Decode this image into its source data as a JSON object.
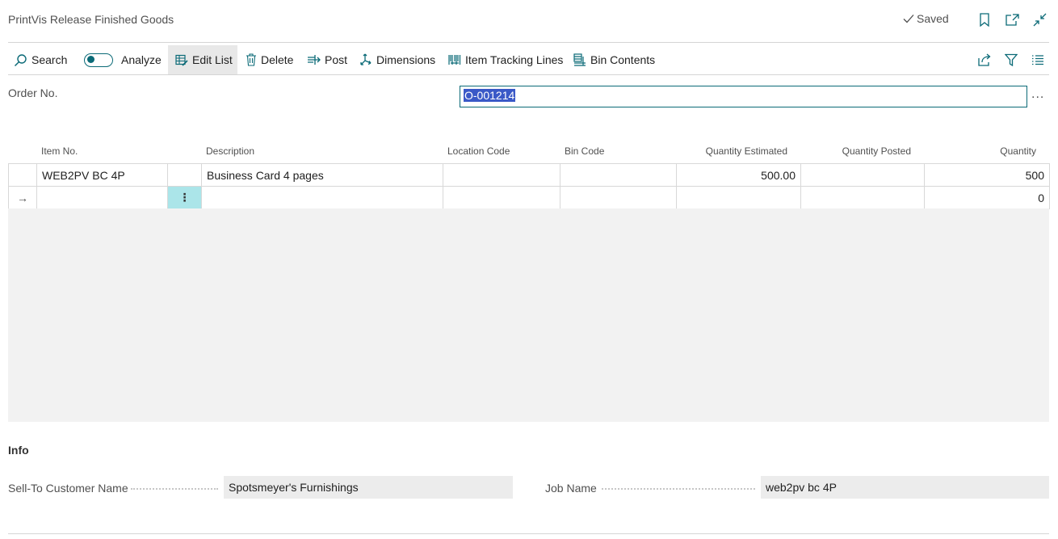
{
  "window": {
    "title": "PrintVis Release Finished Goods",
    "status": "Saved"
  },
  "actions": {
    "search": "Search",
    "analyze": "Analyze",
    "edit_list": "Edit List",
    "delete": "Delete",
    "post": "Post",
    "dimensions": "Dimensions",
    "item_tracking_lines": "Item Tracking Lines",
    "bin_contents": "Bin Contents"
  },
  "header": {
    "order_no_label": "Order No.",
    "order_no_value": "O-001214",
    "more": "..."
  },
  "lines": {
    "columns": {
      "item_no": "Item No.",
      "description": "Description",
      "location_code": "Location Code",
      "bin_code": "Bin Code",
      "quantity_estimated": "Quantity Estimated",
      "quantity_posted": "Quantity Posted",
      "quantity": "Quantity"
    },
    "rows": [
      {
        "item_no": "WEB2PV BC 4P",
        "description": "Business Card 4 pages",
        "location_code": "",
        "bin_code": "",
        "quantity_estimated": "500.00",
        "quantity_posted": "",
        "quantity": "500"
      },
      {
        "item_no": "",
        "description": "",
        "location_code": "",
        "bin_code": "",
        "quantity_estimated": "",
        "quantity_posted": "",
        "quantity": "0"
      }
    ],
    "current_row_marker": "→",
    "row_menu": "⋮"
  },
  "info": {
    "heading": "Info",
    "sell_to_label": "Sell-To Customer Name",
    "sell_to_value": "Spotsmeyer's Furnishings",
    "job_name_label": "Job Name",
    "job_name_value": "web2pv bc 4P"
  },
  "colors": {
    "accent": "#0b6a77",
    "selection": "#3a59c7",
    "row_select": "#abe5e9"
  }
}
